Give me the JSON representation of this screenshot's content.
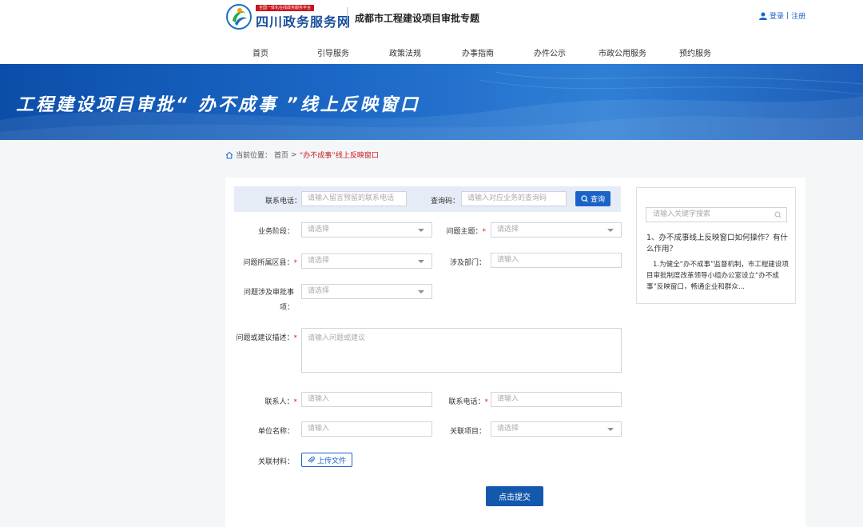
{
  "header": {
    "badge": "全国一体化在线政务服务平台",
    "site_name": "四川政务服务网",
    "topic": "成都市工程建设项目审批专题",
    "login": "登录",
    "separator": "|",
    "register": "注册"
  },
  "nav": [
    "首页",
    "引导服务",
    "政策法规",
    "办事指南",
    "办件公示",
    "市政公用服务",
    "预约服务"
  ],
  "banner": {
    "title": "工程建设项目审批“ 办不成事 ”线上反映窗口"
  },
  "breadcrumb": {
    "prefix": "当前位置：",
    "home": "首页",
    "sep": ">",
    "current": "“办不成事”线上反映窗口"
  },
  "query": {
    "phone_label": "联系电话：",
    "phone_placeholder": "请输入留言预留的联系电话",
    "code_label": "查询码：",
    "code_placeholder": "请输入对应业务的查询码",
    "button": "查询"
  },
  "form": {
    "stage_label": "业务阶段：",
    "stage_value": "请选择",
    "topic_label": "问题主题：",
    "topic_value": "请选择",
    "district_label": "问题所属区县：",
    "district_value": "请选择",
    "dept_label": "涉及部门：",
    "dept_placeholder": "请输入",
    "item_label_1": "问题涉及审批事",
    "item_label_2": "项：",
    "item_value": "请选择",
    "desc_label": "问题或建议描述：",
    "desc_placeholder": "请输入问题或建议",
    "contact_label": "联系人：",
    "contact_placeholder": "请输入",
    "contact_phone_label": "联系电话：",
    "contact_phone_placeholder": "请输入",
    "org_label": "单位名称：",
    "org_placeholder": "请输入",
    "project_label": "关联项目：",
    "project_value": "请选择",
    "material_label": "关联材料：",
    "upload": "上传文件",
    "submit": "点击提交",
    "required_mark": "*"
  },
  "faq": {
    "search_placeholder": "请输入关键字搜索",
    "question": "1、办不成事线上反映窗口如何操作？有什么作用？",
    "answer": "1.为健全“办不成事”监督机制，市工程建设项目审批制度改革领导小组办公室设立“办不成事”反映窗口，畅通企业和群众..."
  },
  "colors": {
    "primary": "#1a64c8",
    "required": "#e02020",
    "banner": "#1c68c6"
  }
}
